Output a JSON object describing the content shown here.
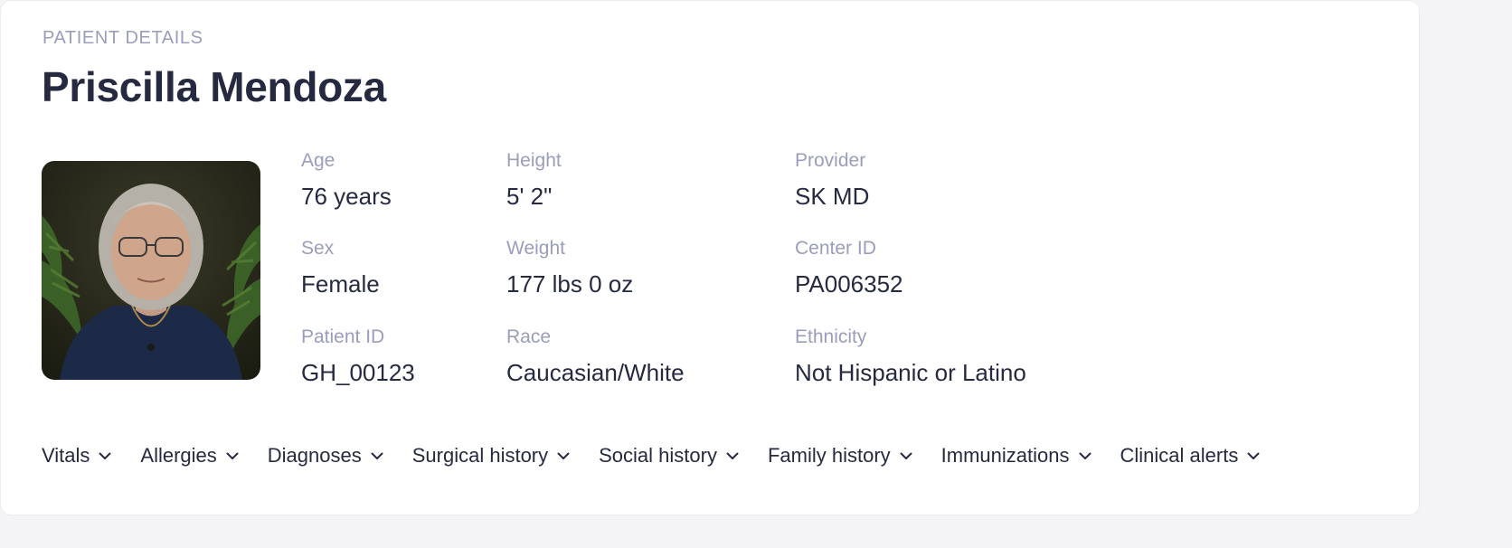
{
  "header": {
    "eyebrow": "PATIENT DETAILS",
    "name": "Priscilla Mendoza"
  },
  "photo": {
    "icon": "patient-photo"
  },
  "fields": {
    "age": {
      "label": "Age",
      "value": "76 years"
    },
    "sex": {
      "label": "Sex",
      "value": "Female"
    },
    "patient_id": {
      "label": "Patient ID",
      "value": "GH_00123"
    },
    "height": {
      "label": "Height",
      "value": "5' 2\""
    },
    "weight": {
      "label": "Weight",
      "value": "177 lbs 0 oz"
    },
    "race": {
      "label": "Race",
      "value": "Caucasian/White"
    },
    "provider": {
      "label": "Provider",
      "value": "SK MD"
    },
    "center_id": {
      "label": "Center ID",
      "value": "PA006352"
    },
    "ethnicity": {
      "label": "Ethnicity",
      "value": "Not Hispanic or Latino"
    }
  },
  "tabs": [
    {
      "label": "Vitals",
      "icon": "chevron-down-icon"
    },
    {
      "label": "Allergies",
      "icon": "chevron-down-icon"
    },
    {
      "label": "Diagnoses",
      "icon": "chevron-down-icon"
    },
    {
      "label": "Surgical history",
      "icon": "chevron-down-icon"
    },
    {
      "label": "Social history",
      "icon": "chevron-down-icon"
    },
    {
      "label": "Family history",
      "icon": "chevron-down-icon"
    },
    {
      "label": "Immunizations",
      "icon": "chevron-down-icon"
    },
    {
      "label": "Clinical alerts",
      "icon": "chevron-down-icon"
    }
  ],
  "colors": {
    "label": "#9a9dbc",
    "text": "#262a41",
    "border": "#ececf0"
  }
}
